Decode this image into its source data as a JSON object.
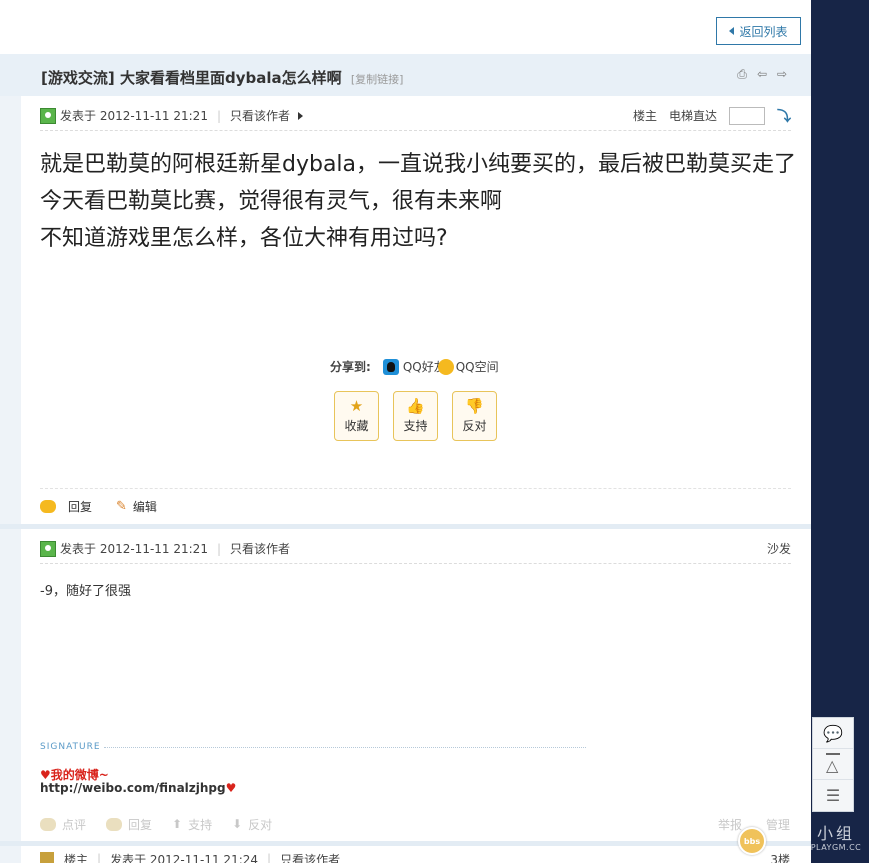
{
  "nav": {
    "back_label": "返回列表"
  },
  "thread": {
    "category": "[游戏交流]",
    "title": "大家看看档里面dybala怎么样啊",
    "copy_link": "[复制链接]"
  },
  "first_post": {
    "posted_at": "发表于 2012-11-11 21:21",
    "author_only": "只看该作者",
    "floor_label": "楼主",
    "jump_label": "电梯直达",
    "content_lines": [
      "就是巴勒莫的阿根廷新星dybala，一直说我小纯要买的，最后被巴勒莫买走了",
      "今天看巴勒莫比赛，觉得很有灵气，很有未来啊",
      "不知道游戏里怎么样，各位大神有用过吗?"
    ],
    "share_label": "分享到:",
    "share_qq": "QQ好友",
    "share_qzone": "QQ空间",
    "actions": {
      "favorite": "收藏",
      "support": "支持",
      "oppose": "反对"
    },
    "reply": "回复",
    "edit": "编辑"
  },
  "second_post": {
    "posted_at": "发表于 2012-11-11 21:21",
    "author_only": "只看该作者",
    "floor_label": "沙发",
    "content": "-9，随好了很强",
    "signature_label": "SIGNATURE",
    "signature_weibo": "♥我的微博~",
    "signature_url": "http://weibo.com/finalzjhpg",
    "signature_heart": "♥",
    "faded_actions": {
      "comment": "点评",
      "reply": "回复",
      "support": "支持",
      "oppose": "反对",
      "report": "举报",
      "manage": "管理"
    }
  },
  "third_post": {
    "floor_short": "楼主",
    "posted_at": "发表于 2012-11-11 21:24",
    "author_only": "只看该作者",
    "floor_label": "3楼"
  },
  "watermark": {
    "logo": "小组",
    "url": "PLAYGM.CC"
  },
  "mascot": {
    "label": "bbs"
  },
  "colors": {
    "accent": "#2f78a8",
    "sidebar": "#172547",
    "header_bg": "#e8f0f7",
    "signature_red": "#d9241c"
  },
  "icons": [
    "print-icon",
    "prev-thread-icon",
    "next-thread-icon",
    "jump-go-icon",
    "star-icon",
    "thumbs-up-icon",
    "thumbs-down-icon",
    "reply-bubble-icon",
    "pencil-icon",
    "comment-icon",
    "back-to-top-icon",
    "list-icon"
  ]
}
